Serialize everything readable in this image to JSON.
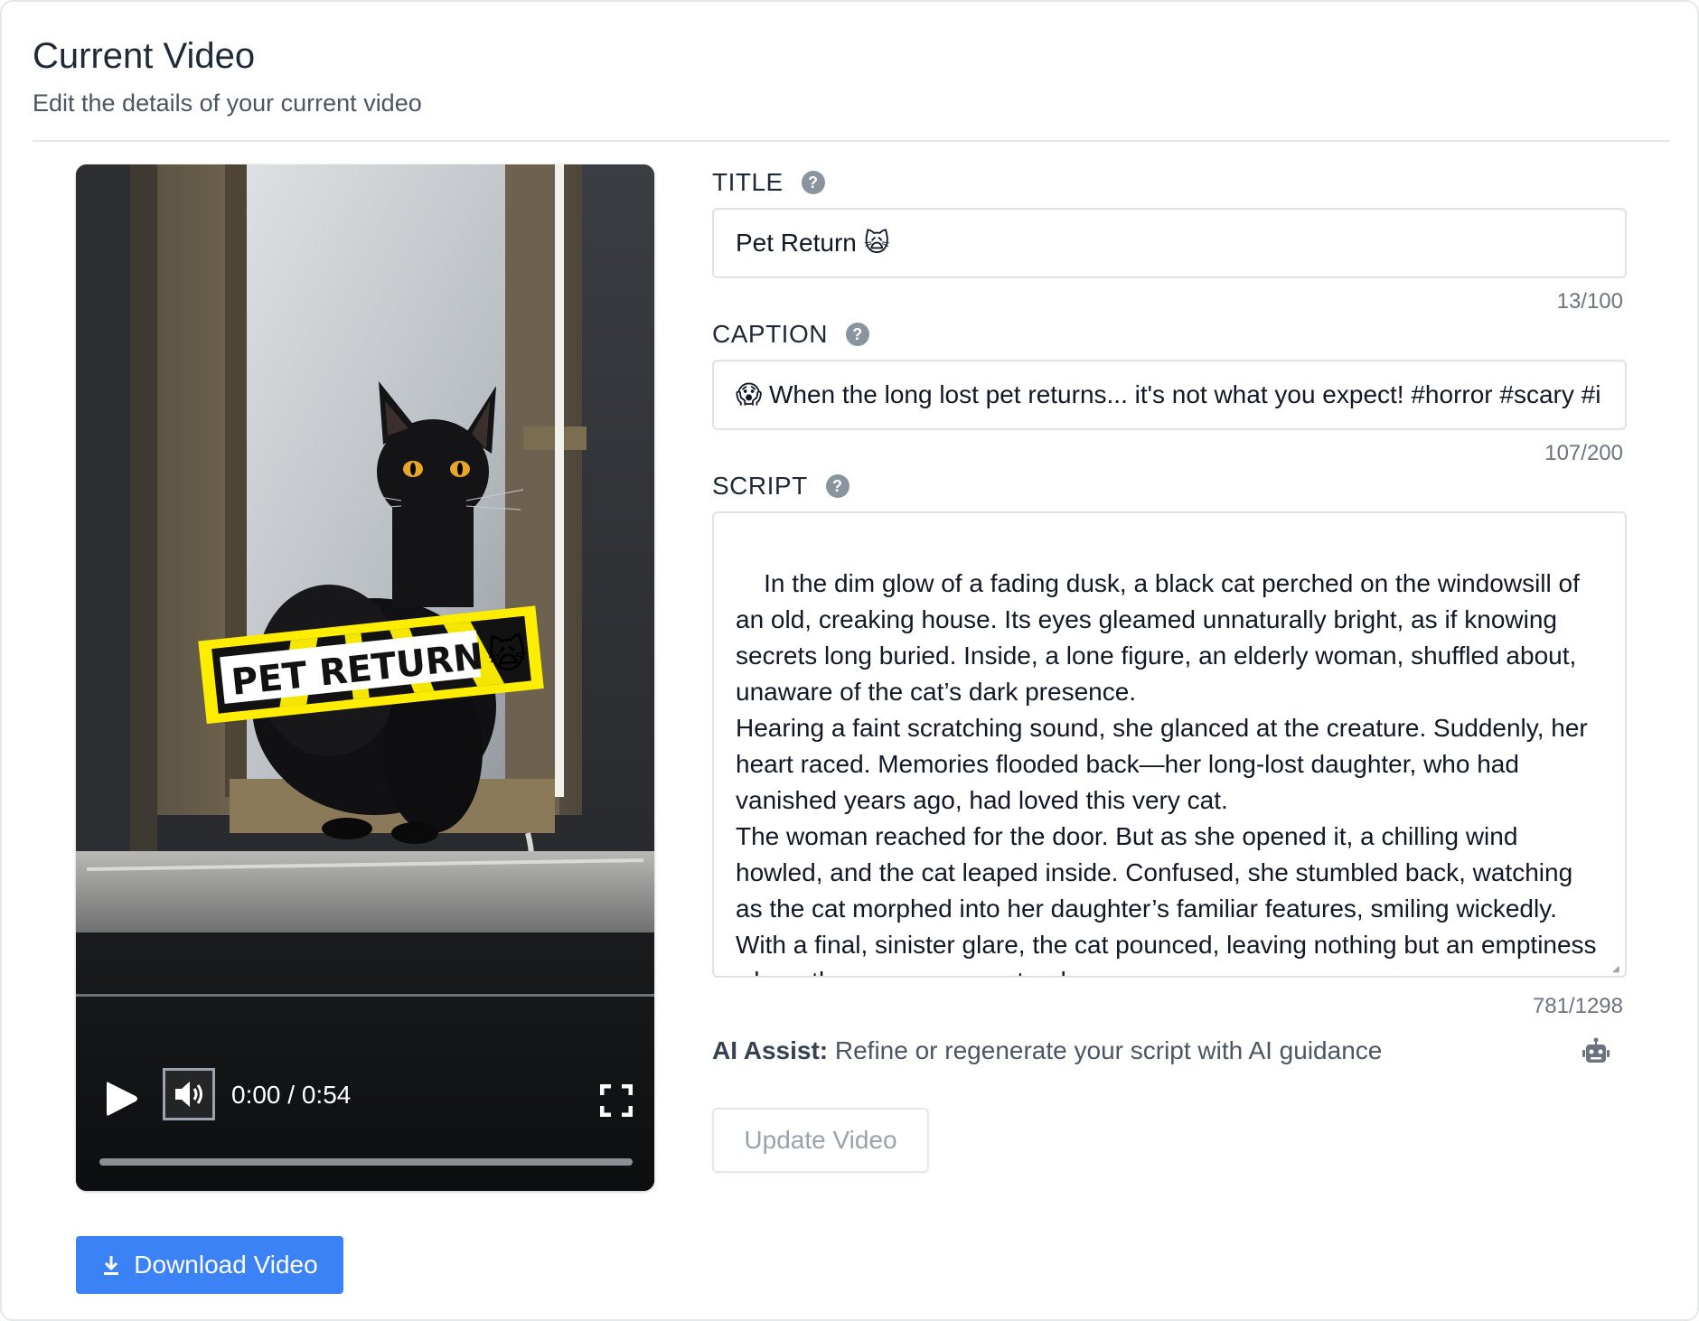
{
  "header": {
    "title": "Current Video",
    "subtitle": "Edit the details of your current video"
  },
  "video": {
    "overlay_text": "PET RETURN",
    "overlay_emoji": "🙀",
    "current_time": "0:00",
    "duration": "0:54",
    "time_separator": " / ",
    "progress_fraction": 0,
    "icons": {
      "play": "play-icon",
      "volume": "volume-icon",
      "fullscreen": "fullscreen-icon"
    }
  },
  "download": {
    "label": "Download Video",
    "icon": "download-icon",
    "color": "#3b82f6"
  },
  "form": {
    "title": {
      "label": "TITLE",
      "value": "Pet Return 🙀",
      "counter": "13/100"
    },
    "caption": {
      "label": "CAPTION",
      "value": "😱 When the long lost pet returns... it's not what you expect! #horror #scary #i",
      "counter": "107/200"
    },
    "script": {
      "label": "SCRIPT",
      "value": "In the dim glow of a fading dusk, a black cat perched on the windowsill of an old, creaking house. Its eyes gleamed unnaturally bright, as if knowing secrets long buried. Inside, a lone figure, an elderly woman, shuffled about, unaware of the cat’s dark presence.\nHearing a faint scratching sound, she glanced at the creature. Suddenly, her heart raced. Memories flooded back—her long-lost daughter, who had vanished years ago, had loved this very cat.\nThe woman reached for the door. But as she opened it, a chilling wind howled, and the cat leaped inside. Confused, she stumbled back, watching as the cat morphed into her daughter’s familiar features, smiling wickedly.\nWith a final, sinister glare, the cat pounced, leaving nothing but an emptiness where the woman once stood.",
      "counter": "781/1298"
    },
    "help_icon": "?"
  },
  "ai_assist": {
    "label": "AI Assist:",
    "text": " Refine or regenerate your script with AI guidance",
    "icon": "robot-icon"
  },
  "update": {
    "label": "Update Video"
  }
}
